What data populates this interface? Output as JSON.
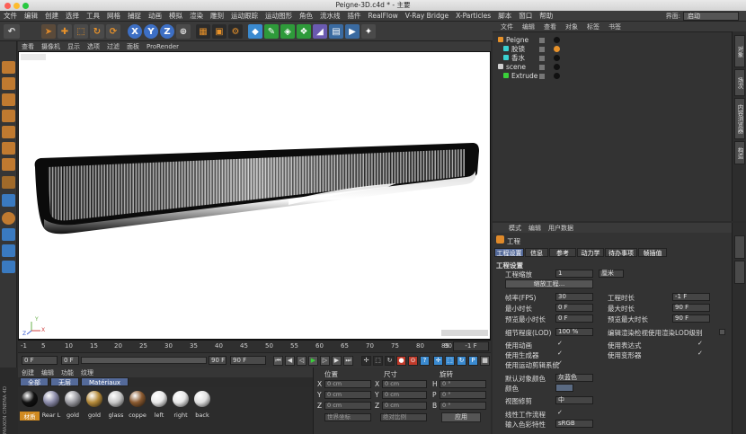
{
  "window": {
    "title": "Peigne-3D.c4d * - 主要"
  },
  "menubar": {
    "items": [
      "文件",
      "编辑",
      "创建",
      "选择",
      "工具",
      "网格",
      "捕捉",
      "动画",
      "模拟",
      "渲染",
      "雕刻",
      "运动跟踪",
      "运动图形",
      "角色",
      "流水线",
      "插件",
      "RealFlow",
      "V-Ray Bridge",
      "X-Particles",
      "脚本",
      "窗口",
      "帮助"
    ],
    "layout_label": "界面:",
    "layout_value": "启动"
  },
  "toolbar": {
    "axis_x": "X",
    "axis_y": "Y",
    "axis_z": "Z"
  },
  "viewport": {
    "menu": [
      "查看",
      "摄像机",
      "显示",
      "选项",
      "过滤",
      "面板",
      "ProRender"
    ],
    "axis_y": "Y",
    "axis_z": "Z",
    "axis_x": "X"
  },
  "timeline": {
    "ticks": [
      "-1",
      "5",
      "10",
      "15",
      "20",
      "25",
      "30",
      "35",
      "40",
      "45",
      "50",
      "55",
      "60",
      "65",
      "70",
      "75",
      "80",
      "85",
      "90"
    ],
    "current_frame": "-1 F",
    "start_field": "0 F",
    "end_field1": "90 F",
    "end_field2": "90 F",
    "left_field": "0 F"
  },
  "material_manager": {
    "menu": [
      "创建",
      "编辑",
      "功能",
      "纹理"
    ],
    "tabs": [
      "全部",
      "无层",
      "Matériaux"
    ],
    "materials": [
      {
        "label": "材质",
        "color": "#111111"
      },
      {
        "label": "Rear L",
        "color": "#8a8aa8"
      },
      {
        "label": "gold",
        "color": "#9a9aa0"
      },
      {
        "label": "gold",
        "color": "#b48a3a"
      },
      {
        "label": "glass",
        "color": "#c8c8c8"
      },
      {
        "label": "coppe",
        "color": "#8a5a30"
      },
      {
        "label": "left",
        "color": "#e8e8e8"
      },
      {
        "label": "right",
        "color": "#e8e8e8"
      },
      {
        "label": "back",
        "color": "#e0e0e0"
      }
    ],
    "brand": "MAXON CINEMA 4D"
  },
  "coordinates": {
    "header": [
      "位置",
      "尺寸",
      "旋转"
    ],
    "rows": [
      {
        "axis": "X",
        "pos": "0 cm",
        "size": "0 cm",
        "rlabel": "H",
        "rot": "0 °"
      },
      {
        "axis": "Y",
        "pos": "0 cm",
        "size": "0 cm",
        "rlabel": "P",
        "rot": "0 °"
      },
      {
        "axis": "Z",
        "pos": "0 cm",
        "size": "0 cm",
        "rlabel": "B",
        "rot": "0 °"
      }
    ],
    "world_select": "世界坐标",
    "scale_select": "绝对比例",
    "apply": "应用"
  },
  "object_manager": {
    "menu": [
      "文件",
      "编辑",
      "查看",
      "对象",
      "标签",
      "书签"
    ],
    "objects": [
      {
        "name": "Peigne",
        "indent": 0
      },
      {
        "name": "胶锁",
        "indent": 1
      },
      {
        "name": "香水",
        "indent": 1
      },
      {
        "name": "scene",
        "indent": 0
      },
      {
        "name": "Extrude",
        "indent": 1
      }
    ],
    "side_tabs": [
      "对象",
      "场次",
      "内容浏览器",
      "构造"
    ]
  },
  "attributes": {
    "menu": [
      "模式",
      "编辑",
      "用户数据"
    ],
    "title": "工程",
    "tabs": [
      "工程设置",
      "信息",
      "参考",
      "动力学",
      "待办事项",
      "帧插值"
    ],
    "section": "工程设置",
    "scale_label": "工程缩放",
    "scale_value": "1",
    "scale_unit": "厘米",
    "scale_button": "缩放工程...",
    "fps_label": "帧率(FPS)",
    "fps_value": "30",
    "proj_time_label": "工程时长",
    "proj_time_value": "-1 F",
    "min_time_label": "最小时长",
    "min_time_value": "0 F",
    "max_time_label": "最大时长",
    "max_time_value": "90 F",
    "prev_min_label": "预览最小时长",
    "prev_min_value": "0 F",
    "prev_max_label": "预览最大时长",
    "prev_max_value": "90 F",
    "lod_label": "细节程度(LOD)",
    "lod_value": "100 %",
    "lod_render_label": "编辑渲染检视使用渲染LOD级别",
    "anim_label": "使用动画",
    "expr_label": "使用表达式",
    "gen_label": "使用生成器",
    "deform_label": "使用变形器",
    "motion_label": "使用运动剪辑系统",
    "default_color_label": "默认对象颜色",
    "default_color_value": "灰蓝色",
    "color_label": "颜色",
    "view_clip_label": "视图修剪",
    "view_clip_value": "中",
    "linear_label": "线性工作流程",
    "input_color_label": "输入色彩特性",
    "input_color_value": "sRGB"
  }
}
